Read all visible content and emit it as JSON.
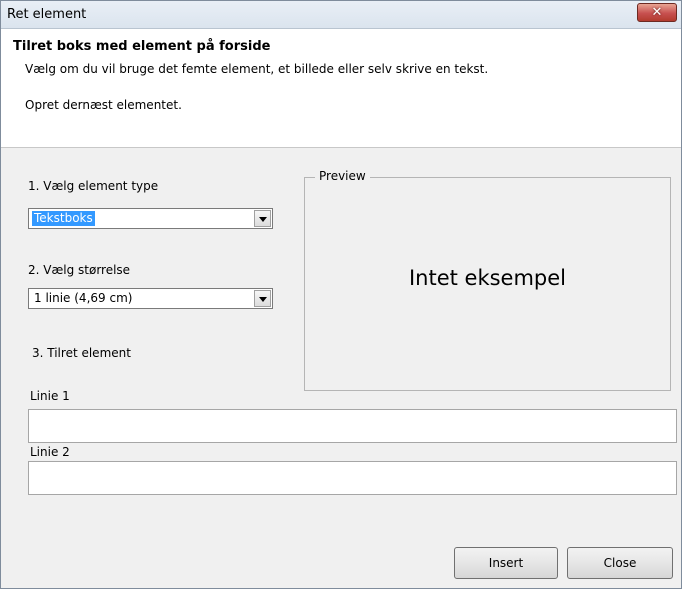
{
  "window": {
    "title": "Ret element",
    "close_glyph": "✕"
  },
  "header": {
    "title": "Tilret boks med element på forside",
    "description": "Vælg om du vil bruge det femte element, et billede eller selv skrive en tekst.",
    "description2": "Opret dernæst elementet."
  },
  "form": {
    "step1_label": "1. Vælg element type",
    "element_type_value": "Tekstboks",
    "step2_label": "2. Vælg størrelse",
    "size_value": "1 linie (4,69 cm)",
    "step3_label": "3. Tilret element",
    "line1_label": "Linie 1",
    "line1_value": "",
    "line2_label": "Linie 2",
    "line2_value": ""
  },
  "preview": {
    "group_label": "Preview",
    "placeholder_text": "Intet eksempel"
  },
  "buttons": {
    "insert_label": "Insert",
    "close_label": "Close"
  },
  "icons": {
    "close": "close-icon",
    "dropdown": "chevron-down-icon"
  }
}
